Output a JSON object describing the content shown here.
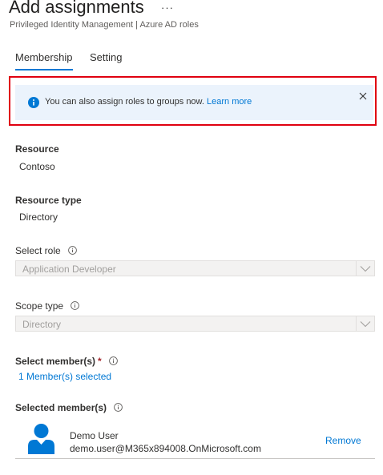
{
  "header": {
    "title": "Add assignments",
    "more_label": "···",
    "subtitle": "Privileged Identity Management | Azure AD roles"
  },
  "tabs": [
    {
      "label": "Membership",
      "active": true
    },
    {
      "label": "Setting",
      "active": false
    }
  ],
  "info_bar": {
    "message": "You can also assign roles to groups now.",
    "link_text": "Learn more",
    "icon": "info-icon",
    "close_icon": "close-icon",
    "highlight_color": "#e00010",
    "background_color": "#ebf3fc"
  },
  "resource": {
    "label": "Resource",
    "value": "Contoso"
  },
  "resource_type": {
    "label": "Resource type",
    "value": "Directory"
  },
  "select_role": {
    "label": "Select role",
    "value": "Application Developer",
    "disabled": true
  },
  "scope_type": {
    "label": "Scope type",
    "value": "Directory",
    "disabled": true
  },
  "select_members": {
    "label": "Select member(s)",
    "required_marker": "*",
    "link_text": "1 Member(s) selected"
  },
  "selected_members": {
    "label": "Selected member(s)",
    "items": [
      {
        "name": "Demo User",
        "email": "demo.user@M365x894008.OnMicrosoft.com",
        "remove_label": "Remove",
        "avatar_icon": "user-avatar-icon"
      }
    ]
  },
  "colors": {
    "accent": "#0078d4",
    "required": "#a4262c"
  }
}
